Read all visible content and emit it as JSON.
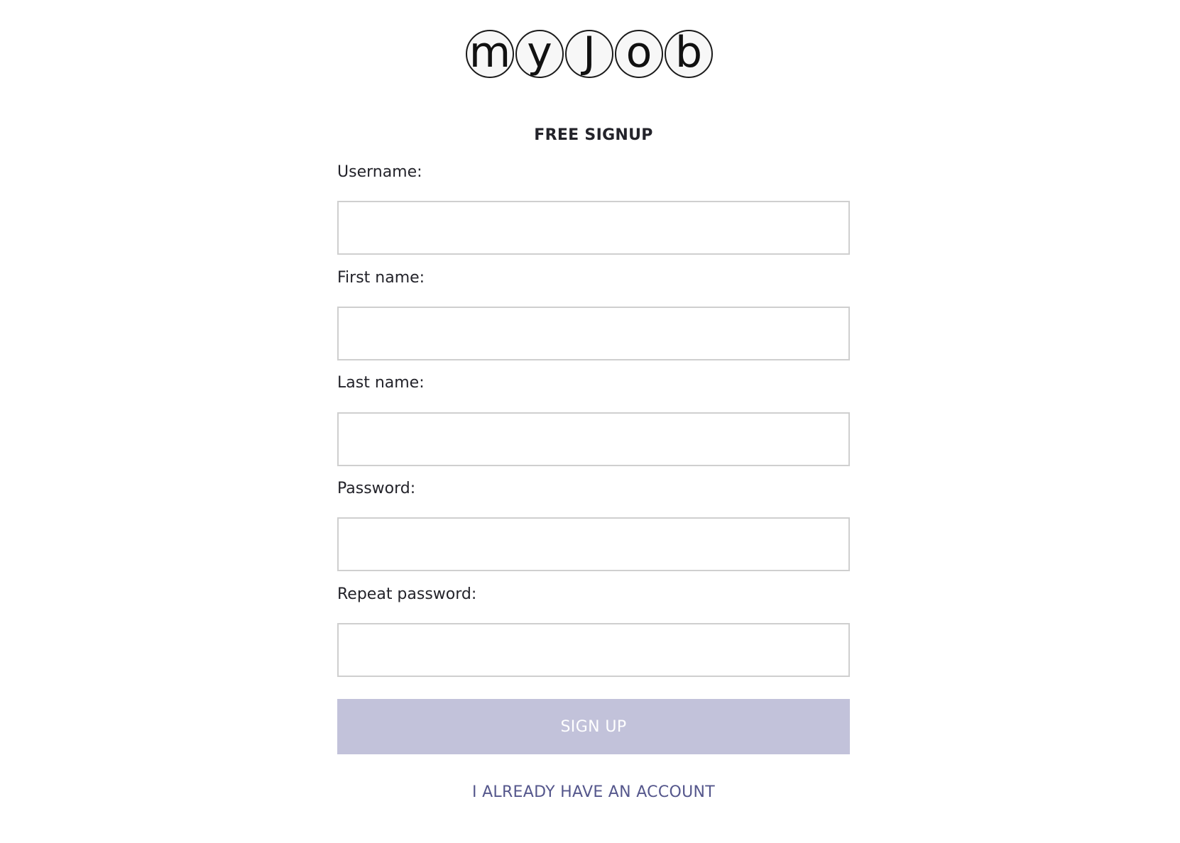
{
  "logo": {
    "letters": [
      "m",
      "y",
      "J",
      "o",
      "b"
    ]
  },
  "form": {
    "title": "FREE SIGNUP",
    "fields": [
      {
        "label": "Username:",
        "value": "",
        "placeholder": ""
      },
      {
        "label": "First name:",
        "value": "",
        "placeholder": ""
      },
      {
        "label": "Last name:",
        "value": "",
        "placeholder": ""
      },
      {
        "label": "Password:",
        "value": "",
        "placeholder": ""
      },
      {
        "label": "Repeat password:",
        "value": "",
        "placeholder": ""
      }
    ],
    "submit_label": "SIGN UP",
    "login_link": "I ALREADY HAVE AN ACCOUNT"
  },
  "colors": {
    "button_bg": "#c2c2da",
    "button_text": "#ffffff",
    "link_text": "#55578c",
    "input_border": "#cfcfcf",
    "text": "#23232a"
  }
}
